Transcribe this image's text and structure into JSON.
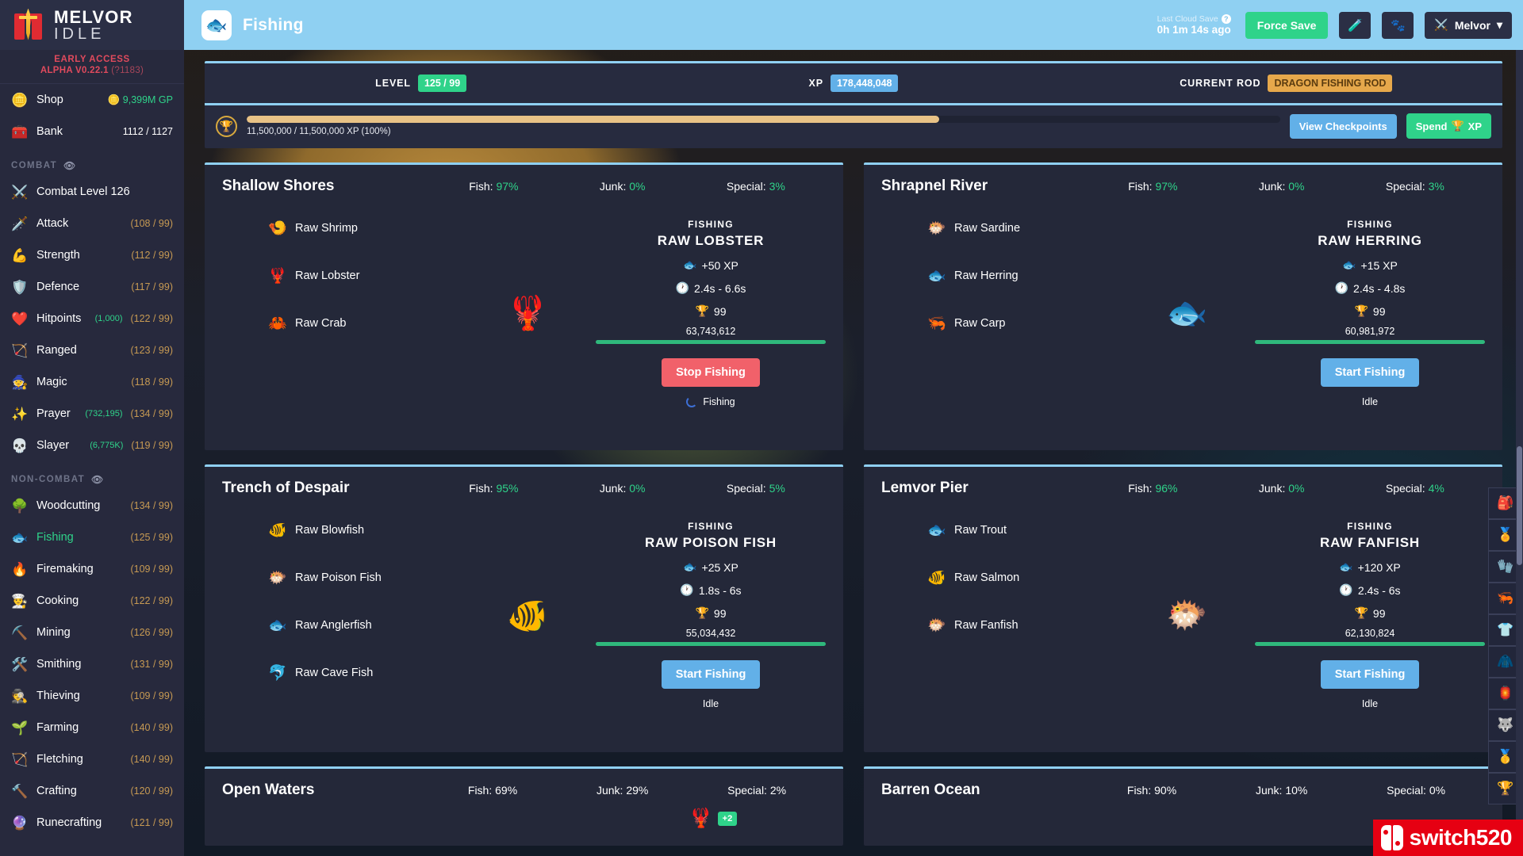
{
  "brand": {
    "line1": "MELVOR",
    "line2": "IDLE",
    "early_access": "EARLY ACCESS",
    "version": "ALPHA V0.22.1",
    "build": "(?1183)"
  },
  "sidebar": {
    "shop": {
      "icon": "coin-icon",
      "label": "Shop",
      "value": "9,399M GP",
      "coin": "🪙"
    },
    "bank": {
      "icon": "chest-icon",
      "label": "Bank",
      "value": "1112 / 1127"
    },
    "combat_header": "COMBAT",
    "noncombat_header": "NON-COMBAT",
    "combat": [
      {
        "icon": "⚔️",
        "icon_name": "swords-icon",
        "label": "Combat Level 126",
        "level": ""
      },
      {
        "icon": "🗡️",
        "icon_name": "sword-icon",
        "label": "Attack",
        "level": "(108 / 99)"
      },
      {
        "icon": "💪",
        "icon_name": "muscle-icon",
        "label": "Strength",
        "level": "(112 / 99)"
      },
      {
        "icon": "🛡️",
        "icon_name": "shield-icon",
        "label": "Defence",
        "level": "(117 / 99)"
      },
      {
        "icon": "❤️",
        "icon_name": "heart-icon",
        "label": "Hitpoints",
        "sub": "(1,000)",
        "level": "(122 / 99)"
      },
      {
        "icon": "🏹",
        "icon_name": "bow-icon",
        "label": "Ranged",
        "level": "(123 / 99)"
      },
      {
        "icon": "🧙",
        "icon_name": "wizard-hat-icon",
        "label": "Magic",
        "level": "(118 / 99)"
      },
      {
        "icon": "✨",
        "icon_name": "sparkle-icon",
        "label": "Prayer",
        "sub": "(732,195)",
        "level": "(134 / 99)"
      },
      {
        "icon": "💀",
        "icon_name": "slayer-icon",
        "label": "Slayer",
        "sub": "(6,775K)",
        "level": "(119 / 99)"
      }
    ],
    "noncombat": [
      {
        "icon": "🌳",
        "icon_name": "tree-icon",
        "label": "Woodcutting",
        "level": "(134 / 99)",
        "active": false
      },
      {
        "icon": "🐟",
        "icon_name": "fish-icon",
        "label": "Fishing",
        "level": "(125 / 99)",
        "active": true
      },
      {
        "icon": "🔥",
        "icon_name": "campfire-icon",
        "label": "Firemaking",
        "level": "(109 / 99)",
        "active": false
      },
      {
        "icon": "👨‍🍳",
        "icon_name": "chef-hat-icon",
        "label": "Cooking",
        "level": "(122 / 99)",
        "active": false
      },
      {
        "icon": "⛏️",
        "icon_name": "pickaxe-icon",
        "label": "Mining",
        "level": "(126 / 99)",
        "active": false
      },
      {
        "icon": "🛠️",
        "icon_name": "anvil-icon",
        "label": "Smithing",
        "level": "(131 / 99)",
        "active": false
      },
      {
        "icon": "🕵️",
        "icon_name": "thief-icon",
        "label": "Thieving",
        "level": "(109 / 99)",
        "active": false
      },
      {
        "icon": "🌱",
        "icon_name": "seedling-icon",
        "label": "Farming",
        "level": "(140 / 99)",
        "active": false
      },
      {
        "icon": "🏹",
        "icon_name": "arrow-icon",
        "label": "Fletching",
        "level": "(140 / 99)",
        "active": false
      },
      {
        "icon": "🔨",
        "icon_name": "tools-icon",
        "label": "Crafting",
        "level": "(120 / 99)",
        "active": false
      },
      {
        "icon": "🔮",
        "icon_name": "rune-icon",
        "label": "Runecrafting",
        "level": "(121 / 99)",
        "active": false
      }
    ]
  },
  "topbar": {
    "page_icon": "🐟",
    "title": "Fishing",
    "cloud_save_label": "Last Cloud Save",
    "cloud_save_help": "?",
    "cloud_save_time": "0h 1m 14s ago",
    "force_save": "Force Save",
    "potion_icon": "🧪",
    "pet_icon": "🐾",
    "user_icon": "⚔️",
    "user_name": "Melvor",
    "chevron": "▾"
  },
  "level_panel": {
    "level_label": "LEVEL",
    "level_value": "125 / 99",
    "xp_label": "XP",
    "xp_value": "178,448,048",
    "rod_label": "CURRENT ROD",
    "rod_value": "DRAGON FISHING ROD",
    "mastery_icon": "🏆",
    "mastery_percent": 100,
    "mastery_bar_visual_percent": 67,
    "mastery_caption": "11,500,000 / 11,500,000 XP (100%)",
    "view_checkpoints": "View Checkpoints",
    "spend_prefix": "Spend",
    "spend_icon": "🏆",
    "spend_suffix": "XP"
  },
  "stat_labels": {
    "fish": "Fish:",
    "junk": "Junk:",
    "special": "Special:"
  },
  "fishing_kicker": "FISHING",
  "areas": [
    {
      "name": "Shallow Shores",
      "fish_pct": "97%",
      "junk_pct": "0%",
      "special_pct": "3%",
      "fishes": [
        {
          "icon": "🍤",
          "icon_name": "raw-shrimp-icon",
          "label": "Raw Shrimp"
        },
        {
          "icon": "🦞",
          "icon_name": "raw-lobster-icon",
          "label": "Raw Lobster"
        },
        {
          "icon": "🦀",
          "icon_name": "raw-crab-icon",
          "label": "Raw Crab"
        }
      ],
      "selected_icon": "🦞",
      "selected_name": "RAW LOBSTER",
      "xp": "+50 XP",
      "xp_icon": "🐟",
      "time": "2.4s - 6.6s",
      "time_icon": "🕐",
      "mastery_icon": "🏆",
      "mastery_level": "99",
      "mastery_xp": "63,743,612",
      "mastery_fill": 100,
      "button": "Stop Fishing",
      "button_state": "stop",
      "status": "Fishing",
      "status_spinner": true
    },
    {
      "name": "Shrapnel River",
      "fish_pct": "97%",
      "junk_pct": "0%",
      "special_pct": "3%",
      "fishes": [
        {
          "icon": "🐡",
          "icon_name": "raw-sardine-icon",
          "label": "Raw Sardine"
        },
        {
          "icon": "🐟",
          "icon_name": "raw-herring-icon",
          "label": "Raw Herring"
        },
        {
          "icon": "🦐",
          "icon_name": "raw-carp-icon",
          "label": "Raw Carp"
        }
      ],
      "selected_icon": "🐟",
      "selected_name": "RAW HERRING",
      "xp": "+15 XP",
      "xp_icon": "🐟",
      "time": "2.4s - 4.8s",
      "time_icon": "🕐",
      "mastery_icon": "🏆",
      "mastery_level": "99",
      "mastery_xp": "60,981,972",
      "mastery_fill": 100,
      "button": "Start Fishing",
      "button_state": "start",
      "status": "Idle",
      "status_spinner": false
    },
    {
      "name": "Trench of Despair",
      "fish_pct": "95%",
      "junk_pct": "0%",
      "special_pct": "5%",
      "fishes": [
        {
          "icon": "🐠",
          "icon_name": "raw-blowfish-icon",
          "label": "Raw Blowfish"
        },
        {
          "icon": "🐡",
          "icon_name": "raw-poison-fish-icon",
          "label": "Raw Poison Fish"
        },
        {
          "icon": "🐟",
          "icon_name": "raw-anglerfish-icon",
          "label": "Raw Anglerfish"
        },
        {
          "icon": "🐬",
          "icon_name": "raw-cave-fish-icon",
          "label": "Raw Cave Fish"
        }
      ],
      "selected_icon": "🐠",
      "selected_name": "RAW POISON FISH",
      "xp": "+25 XP",
      "xp_icon": "🐟",
      "time": "1.8s - 6s",
      "time_icon": "🕐",
      "mastery_icon": "🏆",
      "mastery_level": "99",
      "mastery_xp": "55,034,432",
      "mastery_fill": 100,
      "button": "Start Fishing",
      "button_state": "start",
      "status": "Idle",
      "status_spinner": false
    },
    {
      "name": "Lemvor Pier",
      "fish_pct": "96%",
      "junk_pct": "0%",
      "special_pct": "4%",
      "fishes": [
        {
          "icon": "🐟",
          "icon_name": "raw-trout-icon",
          "label": "Raw Trout"
        },
        {
          "icon": "🐠",
          "icon_name": "raw-salmon-icon",
          "label": "Raw Salmon"
        },
        {
          "icon": "🐡",
          "icon_name": "raw-fanfish-icon",
          "label": "Raw Fanfish"
        }
      ],
      "selected_icon": "🐡",
      "selected_name": "RAW FANFISH",
      "xp": "+120 XP",
      "xp_icon": "🐟",
      "time": "2.4s - 6s",
      "time_icon": "🕐",
      "mastery_icon": "🏆",
      "mastery_level": "99",
      "mastery_xp": "62,130,824",
      "mastery_fill": 100,
      "button": "Start Fishing",
      "button_state": "start",
      "status": "Idle",
      "status_spinner": false
    }
  ],
  "areas_bottom": [
    {
      "name": "Open Waters",
      "fish_pct": "69%",
      "junk_pct": "29%",
      "special_pct": "2%",
      "extra_icon": "🦞",
      "extra_badge": "+2"
    },
    {
      "name": "Barren Ocean",
      "fish_pct": "90%",
      "junk_pct": "10%",
      "special_pct": "0%",
      "extra_icon": "",
      "extra_badge": ""
    }
  ],
  "rail": [
    {
      "icon": "🎒",
      "icon_name": "bag-icon"
    },
    {
      "icon": "🏅",
      "icon_name": "medal-icon"
    },
    {
      "icon": "🧤",
      "icon_name": "glove-icon"
    },
    {
      "icon": "🦐",
      "icon_name": "shrimp-icon"
    },
    {
      "icon": "👕",
      "icon_name": "shirt-icon"
    },
    {
      "icon": "🧥",
      "icon_name": "jacket-icon"
    },
    {
      "icon": "🏮",
      "icon_name": "lantern-icon"
    },
    {
      "icon": "🐺",
      "icon_name": "wolf-icon"
    },
    {
      "icon": "🥇",
      "icon_name": "gold-medal-icon"
    },
    {
      "icon": "🏆",
      "icon_name": "trophy-icon"
    }
  ],
  "watermark": {
    "text": "switch520"
  },
  "colors": {
    "accent_blue": "#8fd0f2",
    "green": "#2fd38a",
    "red": "#f1616a",
    "orange": "#e6a84b",
    "sidebar_bg": "#27293d",
    "card_bg": "#242839"
  }
}
